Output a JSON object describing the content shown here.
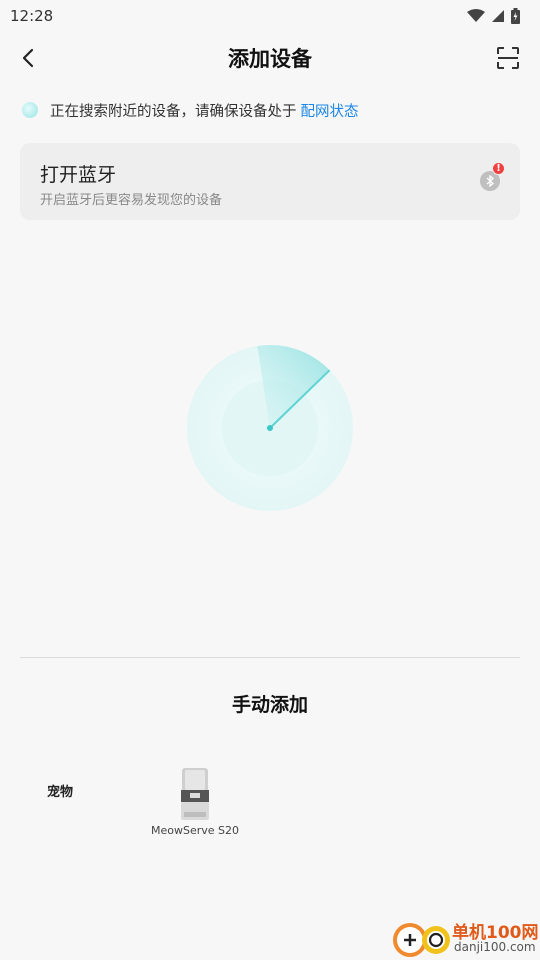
{
  "status_bar": {
    "time": "12:28"
  },
  "header": {
    "title": "添加设备"
  },
  "search_status": {
    "text": "正在搜索附近的设备，请确保设备处于",
    "link": "配网状态"
  },
  "bluetooth_card": {
    "title": "打开蓝牙",
    "subtitle": "开启蓝牙后更容易发现您的设备",
    "badge": "!"
  },
  "manual": {
    "title": "手动添加",
    "category": "宠物",
    "devices": [
      {
        "name": "MeowServe S20"
      }
    ]
  },
  "watermark": {
    "line1": "单机100网",
    "line2": "danji100.com"
  },
  "colors": {
    "accent": "#1a86e8",
    "radar": "#5fd3d3",
    "alert": "#f04040"
  }
}
